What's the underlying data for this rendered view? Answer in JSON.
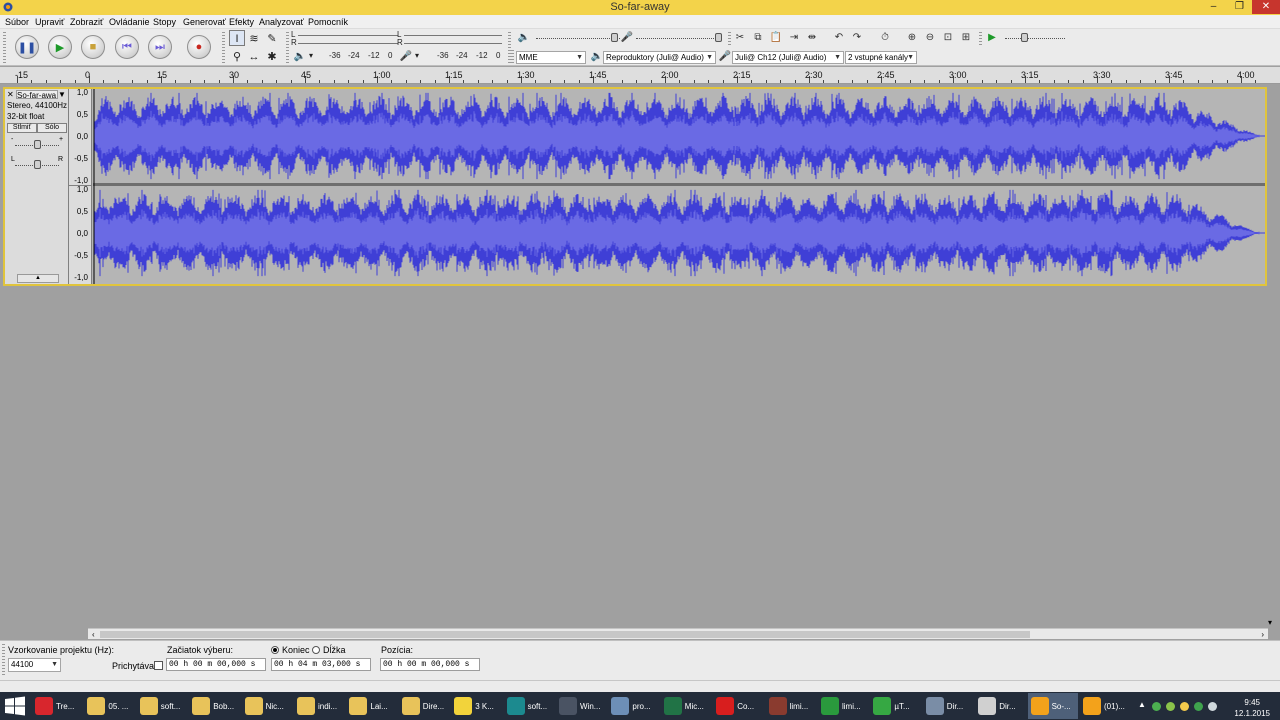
{
  "window": {
    "title": "So-far-away"
  },
  "menu": [
    "Súbor",
    "Upraviť",
    "Zobraziť",
    "Ovládanie",
    "Stopy",
    "Generovať",
    "Efekty",
    "Analyzovať",
    "Pomocník"
  ],
  "meters": {
    "play_channels": [
      "L",
      "R"
    ],
    "rec_channels": [
      "L",
      "R"
    ],
    "play_ticks": [
      "-36",
      "-24",
      "-12",
      "0"
    ],
    "rec_ticks": [
      "-36",
      "-24",
      "-12",
      "0"
    ]
  },
  "devices": {
    "host": "MME",
    "output": "Reproduktory (Juli@ Audio)",
    "input": "Juli@ Ch12 (Juli@ Audio)",
    "channels": "2 vstupné kanály"
  },
  "timeline": {
    "labels": [
      "-15",
      "0",
      "15",
      "30",
      "45",
      "1:00",
      "1:15",
      "1:30",
      "1:45",
      "2:00",
      "2:15",
      "2:30",
      "2:45",
      "3:00",
      "3:15",
      "3:30",
      "3:45",
      "4:00"
    ]
  },
  "track": {
    "name": "So-far-awa",
    "format": "Stereo, 44100Hz",
    "bitdepth": "32-bit float",
    "mute": "Stlmiť",
    "solo": "Sólo",
    "gain_minus": "-",
    "gain_plus": "+",
    "pan_left": "L",
    "pan_right": "R",
    "scale_labels": [
      "1,0",
      "0,5",
      "0,0",
      "-0,5",
      "-1,0"
    ],
    "duration_seconds": 243,
    "wave_color": "#3f3fd6",
    "wave_core_color": "#6a6ae4"
  },
  "selection_toolbar": {
    "rate_label": "Vzorkovanie projektu (Hz):",
    "rate_value": "44100",
    "snap_label": "Prichytávať",
    "start_label": "Začiatok výberu:",
    "end_label": "Koniec",
    "length_label": "Dĺžka",
    "position_label": "Pozícia:",
    "start_value": "00 h 00 m 00,000 s",
    "end_value": "00 h 04 m 03,000 s",
    "position_value": "00 h 00 m 00,000 s"
  },
  "taskbar": {
    "items": [
      {
        "label": "Tre...",
        "color": "#d8262d"
      },
      {
        "label": "05. ...",
        "color": "#e8c35a"
      },
      {
        "label": "soft...",
        "color": "#e8c35a"
      },
      {
        "label": "Bob...",
        "color": "#e8c35a"
      },
      {
        "label": "Nic...",
        "color": "#e8c35a"
      },
      {
        "label": "indi...",
        "color": "#e8c35a"
      },
      {
        "label": "Lai...",
        "color": "#e8c35a"
      },
      {
        "label": "Dire...",
        "color": "#e8c35a"
      },
      {
        "label": "3 K...",
        "color": "#f2d33b"
      },
      {
        "label": "soft...",
        "color": "#1c8a8f"
      },
      {
        "label": "Win...",
        "color": "#4a5363"
      },
      {
        "label": "pro...",
        "color": "#6d8fb7"
      },
      {
        "label": "Mic...",
        "color": "#217346"
      },
      {
        "label": "Co...",
        "color": "#d81e1e"
      },
      {
        "label": "limi...",
        "color": "#8a3b2f"
      },
      {
        "label": "limi...",
        "color": "#2a9a3d"
      },
      {
        "label": "µT...",
        "color": "#36a843"
      },
      {
        "label": "Dir...",
        "color": "#7a8da6"
      },
      {
        "label": "Dir...",
        "color": "#d0d0d0"
      },
      {
        "label": "So-...",
        "color": "#f3a21b"
      },
      {
        "label": "(01)...",
        "color": "#f3a21b"
      }
    ],
    "clock_time": "9:45",
    "clock_date": "12.1.2015"
  }
}
